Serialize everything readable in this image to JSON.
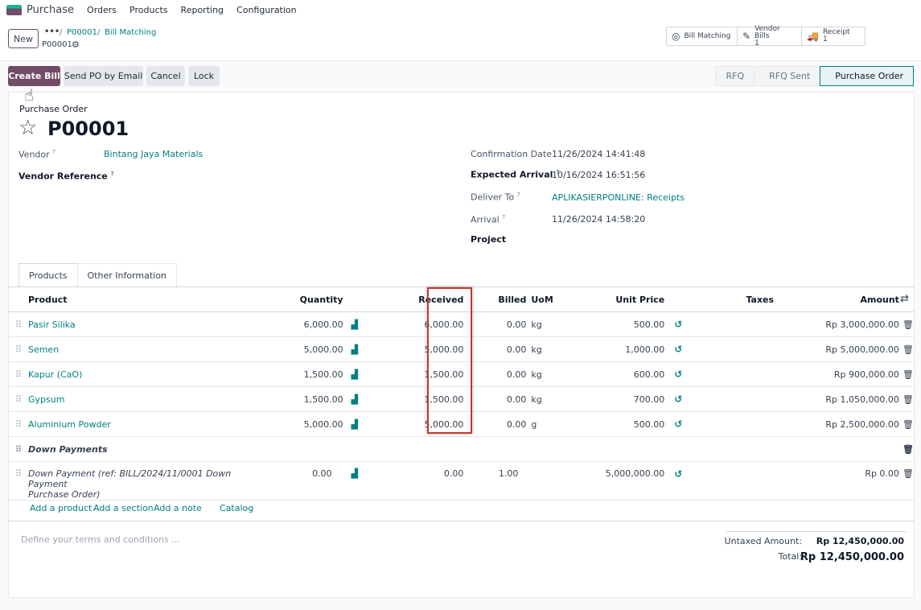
{
  "app": {
    "name": "Purchase",
    "menu": [
      "Orders",
      "Products",
      "Reporting",
      "Configuration"
    ]
  },
  "breadcrumb": {
    "new_label": "New",
    "dots": "•••",
    "items": [
      "P00001",
      "Bill Matching"
    ],
    "current": "P00001"
  },
  "smart_buttons": {
    "bill_matching": {
      "label": "Bill Matching",
      "icon": "bullseye-icon"
    },
    "vendor_bills": {
      "label": "Vendor Bills",
      "count": "1",
      "icon": "edit-icon"
    },
    "receipt": {
      "label": "Receipt",
      "count": "1",
      "icon": "truck-icon"
    }
  },
  "actions": {
    "create_bill": "Create Bill",
    "send_po": "Send PO by Email",
    "cancel": "Cancel",
    "lock": "Lock"
  },
  "status": [
    "RFQ",
    "RFQ Sent",
    "Purchase Order"
  ],
  "status_active": "Purchase Order",
  "form": {
    "doc_type": "Purchase Order",
    "name": "P00001",
    "vendor_label": "Vendor",
    "vendor_value": "Bintang Jaya Materials",
    "vendor_ref_label": "Vendor Reference",
    "confirmation_label": "Confirmation Date",
    "confirmation_value": "11/26/2024 14:41:48",
    "expected_label": "Expected Arrival",
    "expected_value": "10/16/2024 16:51:56",
    "deliver_label": "Deliver To",
    "deliver_value": "APLIKASIERPONLINE: Receipts",
    "arrival_label": "Arrival",
    "arrival_value": "11/26/2024 14:58:20",
    "project_label": "Project"
  },
  "tabs": [
    "Products",
    "Other Information"
  ],
  "table": {
    "headers": {
      "product": "Product",
      "quantity": "Quantity",
      "received": "Received",
      "billed": "Billed",
      "uom": "UoM",
      "unit_price": "Unit Price",
      "taxes": "Taxes",
      "amount": "Amount"
    },
    "rows": [
      {
        "product": "Pasir Silika",
        "quantity": "6,000.00",
        "received": "6,000.00",
        "billed": "0.00",
        "uom": "kg",
        "unit_price": "500.00",
        "amount": "Rp 3,000,000.00"
      },
      {
        "product": "Semen",
        "quantity": "5,000.00",
        "received": "5,000.00",
        "billed": "0.00",
        "uom": "kg",
        "unit_price": "1,000.00",
        "amount": "Rp 5,000,000.00"
      },
      {
        "product": "Kapur (CaO)",
        "quantity": "1,500.00",
        "received": "1,500.00",
        "billed": "0.00",
        "uom": "kg",
        "unit_price": "600.00",
        "amount": "Rp 900,000.00"
      },
      {
        "product": "Gypsum",
        "quantity": "1,500.00",
        "received": "1,500.00",
        "billed": "0.00",
        "uom": "kg",
        "unit_price": "700.00",
        "amount": "Rp 1,050,000.00"
      },
      {
        "product": "Aluminium Powder",
        "quantity": "5,000.00",
        "received": "5,000.00",
        "billed": "0.00",
        "uom": "g",
        "unit_price": "500.00",
        "amount": "Rp 2,500,000.00"
      }
    ],
    "section": "Down Payments",
    "down_payment": {
      "product_line1": "Down Payment (ref: BILL/2024/11/0001 Down Payment",
      "product_line2": "Purchase Order)",
      "quantity": "0.00",
      "received": "0.00",
      "billed": "1.00",
      "unit_price": "5,000,000.00",
      "amount": "Rp 0.00"
    },
    "add_links": [
      "Add a product",
      "Add a section",
      "Add a note",
      "Catalog"
    ]
  },
  "terms_placeholder": "Define your terms and conditions ...",
  "totals": {
    "untaxed_label": "Untaxed Amount:",
    "untaxed_value": "Rp 12,450,000.00",
    "total_label": "Total:",
    "total_value": "Rp 12,450,000.00"
  },
  "colors": {
    "brand": "#714b67",
    "link": "#017e84",
    "highlight": "#c0392b"
  }
}
